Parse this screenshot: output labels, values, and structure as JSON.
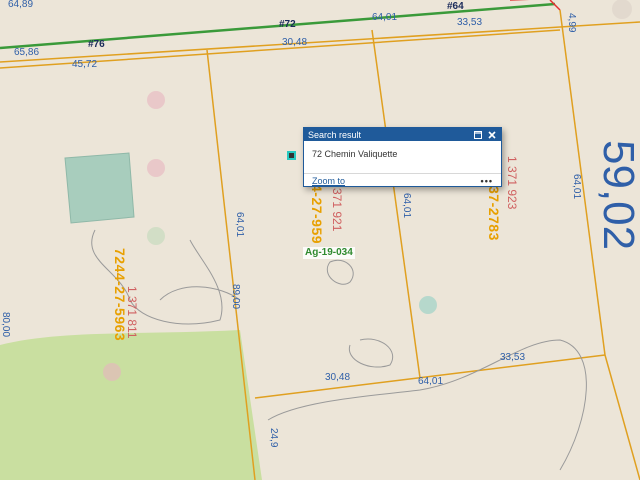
{
  "map": {
    "roads": [
      "#76",
      "#72",
      "#64"
    ],
    "dimensions": {
      "d6489": "64,89",
      "d6586": "65,86",
      "d4572": "45,72",
      "d3048_top": "30,48",
      "d6401_top": "64,01",
      "d3353_top": "33,53",
      "d499": "4,99",
      "d6401_mid": "64,01",
      "d8900": "89,00",
      "d6401_lot2": "64,01",
      "d6401_right": "64,01",
      "d3048_bottom": "30,48",
      "d6401_bottom": "64,01",
      "d3353_bottom": "33,53",
      "d2490": "24,9",
      "d8000": "80,00"
    },
    "big_label": "59,02",
    "lots": {
      "lot_a_code": "7244-27-5963",
      "lot_a_number": "1 371 811",
      "lot_b_code": "4-27-959",
      "lot_b_number": "371 921",
      "lot_c_code": "37-2783",
      "lot_c_number": "1 371 923"
    },
    "zone": "Ag-19-034"
  },
  "popup": {
    "title": "Search result",
    "address": "72 Chemin Valiquette",
    "zoom_label": "Zoom to",
    "more_label": "•••"
  },
  "colors": {
    "background": "#ece5d8",
    "green_area": "#c9dfa0",
    "parcel_line": "#e0a020",
    "road_line": "#3a9a3a",
    "red_line": "#e03030",
    "popup_header": "#1f5a9a",
    "building": "#a8cdbd"
  }
}
